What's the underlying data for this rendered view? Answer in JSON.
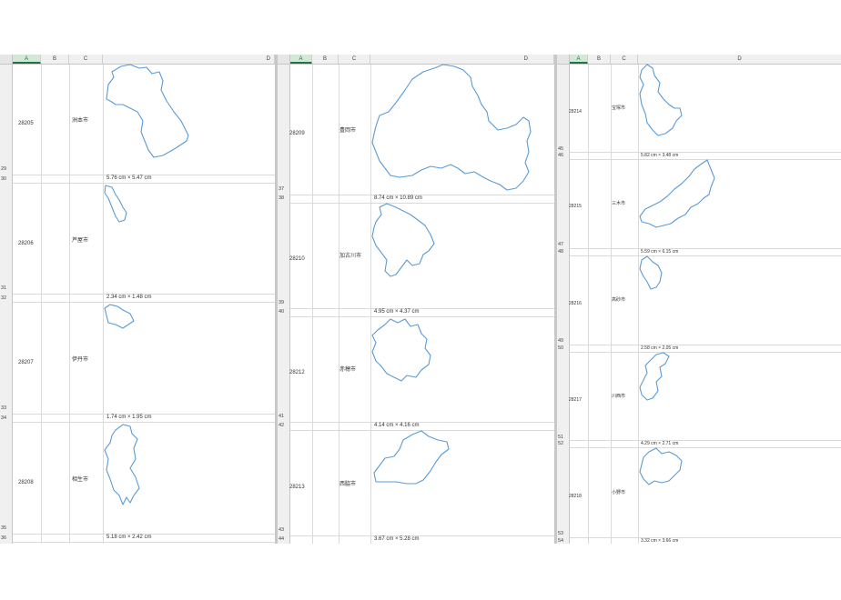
{
  "panes": [
    {
      "columns": [
        "A",
        "B",
        "C",
        "D"
      ],
      "rows": [
        {
          "num_top": "29",
          "num_bottom": "30",
          "code": "28205",
          "city": "洲本市",
          "dim": "5.76 cm × 5.47 cm"
        },
        {
          "num_top": "31",
          "num_bottom": "32",
          "code": "28206",
          "city": "芦屋市",
          "dim": "2.34 cm × 1.48 cm"
        },
        {
          "num_top": "33",
          "num_bottom": "34",
          "code": "28207",
          "city": "伊丹市",
          "dim": "1.74 cm × 1.95 cm"
        },
        {
          "num_top": "35",
          "num_bottom": "36",
          "code": "28208",
          "city": "相生市",
          "dim": "5.18 cm × 2.42 cm"
        }
      ]
    },
    {
      "columns": [
        "A",
        "B",
        "C",
        "D"
      ],
      "rows": [
        {
          "num_top": "37",
          "num_bottom": "38",
          "code": "28209",
          "city": "豊岡市",
          "dim": "8.74 cm × 10.89 cm"
        },
        {
          "num_top": "39",
          "num_bottom": "40",
          "code": "28210",
          "city": "加古川市",
          "dim": "4.95 cm × 4.37 cm"
        },
        {
          "num_top": "41",
          "num_bottom": "42",
          "code": "28212",
          "city": "赤穂市",
          "dim": "4.14 cm × 4.16 cm"
        },
        {
          "num_top": "43",
          "num_bottom": "44",
          "code": "28213",
          "city": "西脇市",
          "dim": "3.67 cm × 5.28 cm"
        }
      ]
    },
    {
      "columns": [
        "A",
        "B",
        "C",
        "D"
      ],
      "rows": [
        {
          "num_top": "45",
          "num_bottom": "46",
          "code": "28214",
          "city": "宝塚市",
          "dim": "5.82 cm × 3.48 cm"
        },
        {
          "num_top": "47",
          "num_bottom": "48",
          "code": "28215",
          "city": "三木市",
          "dim": "5.59 cm × 6.15 cm"
        },
        {
          "num_top": "49",
          "num_bottom": "50",
          "code": "28216",
          "city": "高砂市",
          "dim": "2.58 cm × 2.05 cm"
        },
        {
          "num_top": "51",
          "num_bottom": "52",
          "code": "28217",
          "city": "川西市",
          "dim": "4.29 cm × 2.71 cm"
        },
        {
          "num_top": "53",
          "num_bottom": "54",
          "code": "28218",
          "city": "小野市",
          "dim": "3.32 cm × 3.66 cm"
        }
      ]
    }
  ],
  "colors": {
    "outline": "#5b9bd5",
    "header_bg": "#f0f0f0",
    "selected_col": "#217346"
  },
  "icons": {
    "corner": "select-all-triangle-icon"
  }
}
